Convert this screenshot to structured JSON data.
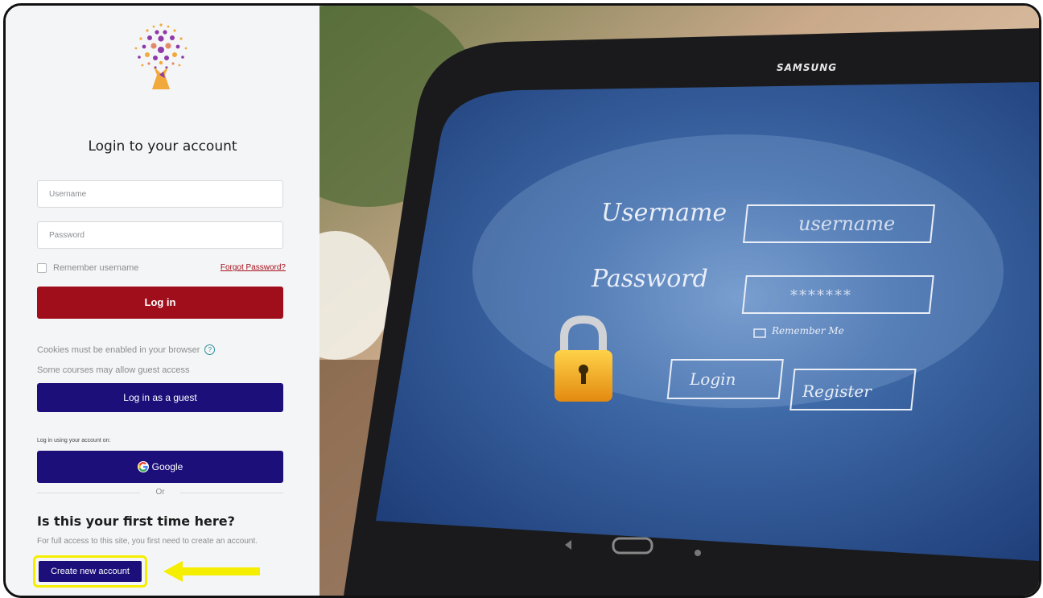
{
  "login": {
    "title": "Login to your account",
    "username_placeholder": "Username",
    "password_placeholder": "Password",
    "remember_label": "Remember username",
    "forgot_link": "Forgot Password?",
    "login_button": "Log in"
  },
  "guest": {
    "cookies_text": "Cookies must be enabled in your browser",
    "guest_info": "Some courses may allow guest access",
    "guest_button": "Log in as a guest"
  },
  "sso": {
    "using_label": "Log in using your account on:",
    "google_button": "Google",
    "or_text": "Or"
  },
  "signup": {
    "heading": "Is this your first time here?",
    "description": "For full access to this site, you first need to create an account.",
    "create_button": "Create new account"
  },
  "photo": {
    "brand": "SAMSUNG",
    "username_label": "Username",
    "username_value": "username",
    "password_label": "Password",
    "password_value": "*******",
    "remember_label": "Remember Me",
    "login_label": "Login",
    "register_label": "Register"
  },
  "colors": {
    "login_button": "#a00e1c",
    "primary_button": "#1c0f7a",
    "highlight": "#f5ee00",
    "link": "#a4101d"
  },
  "icons": [
    "tree-logo-icon",
    "help-icon",
    "google-icon",
    "arrow-left-icon",
    "padlock-icon"
  ]
}
